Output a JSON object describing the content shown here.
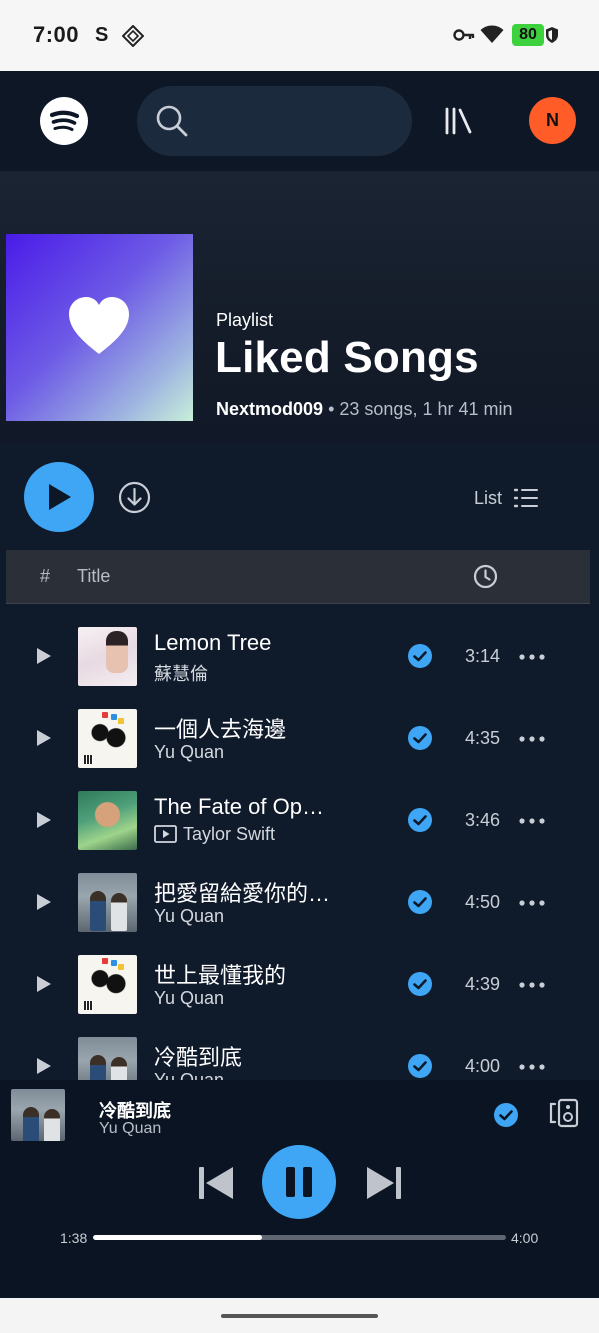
{
  "status_bar": {
    "time": "7:00",
    "carrier_glyph": "S",
    "battery": "80"
  },
  "nav": {
    "logo_icon": "spotify-logo",
    "search": {
      "placeholder": "",
      "value": ""
    },
    "library_icon": "library-icon",
    "avatar_initial": "N"
  },
  "playlist": {
    "type_label": "Playlist",
    "title": "Liked Songs",
    "owner": "Nextmod009",
    "separator": "•",
    "summary": "23 songs, 1 hr 41 min",
    "cover_colors": [
      "#4a1be8",
      "#c8efd9"
    ]
  },
  "actions": {
    "view_label": "List"
  },
  "table_header": {
    "number": "#",
    "title": "Title"
  },
  "songs": [
    {
      "title": "Lemon Tree",
      "artist": "蘇慧倫",
      "duration": "3:14",
      "liked": true,
      "video": false
    },
    {
      "title": "一個人去海邊",
      "artist": "Yu Quan",
      "duration": "4:35",
      "liked": true,
      "video": false
    },
    {
      "title": "The Fate of Op…",
      "artist": "Taylor Swift",
      "duration": "3:46",
      "liked": true,
      "video": true
    },
    {
      "title": "把愛留給愛你的…",
      "artist": "Yu Quan",
      "duration": "4:50",
      "liked": true,
      "video": false
    },
    {
      "title": "世上最懂我的",
      "artist": "Yu Quan",
      "duration": "4:39",
      "liked": true,
      "video": false
    },
    {
      "title": "冷酷到底",
      "artist": "Yu Quan",
      "duration": "4:00",
      "liked": true,
      "video": false
    }
  ],
  "now_playing": {
    "title": "冷酷到底",
    "artist": "Yu Quan",
    "elapsed": "1:38",
    "total": "4:00",
    "progress": 0.41,
    "liked": true
  },
  "colors": {
    "accent": "#3ea6f4",
    "avatar": "#ff5c28",
    "background": "#0f1a2b",
    "battery": "#3dd13d"
  }
}
